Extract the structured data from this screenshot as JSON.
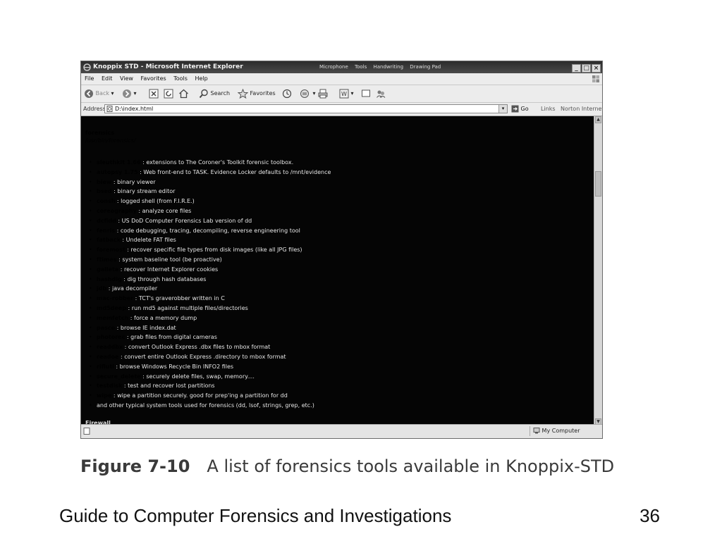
{
  "window": {
    "title": "Knoppix STD - Microsoft Internet Explorer",
    "quick_launch": [
      "Microphone",
      "Tools",
      "Handwriting",
      "Drawing Pad"
    ]
  },
  "menu": [
    "File",
    "Edit",
    "View",
    "Favorites",
    "Tools",
    "Help"
  ],
  "toolbar": {
    "back_label": "Back",
    "search_label": "Search",
    "favorites_label": "Favorites"
  },
  "address": {
    "label": "Address",
    "value": "D:\\index.html",
    "go_label": "Go",
    "links_label": "Links",
    "norton_label": "Norton Internet Security"
  },
  "page": {
    "heading": "forensics",
    "path": "/usr/bin/forensics/",
    "tools": [
      {
        "name": "sleuthkit 1.66",
        "desc": " : extensions to The Coroner's Toolkit forensic toolbox."
      },
      {
        "name": "autopsy 1.75",
        "desc": " : Web front-end to TASK. Evidence Locker defaults to /mnt/evidence"
      },
      {
        "name": "biew",
        "desc": " : binary viewer"
      },
      {
        "name": "bsed",
        "desc": " : binary stream editor"
      },
      {
        "name": "consh",
        "desc": " : logged shell (from F.I.R.E.)"
      },
      {
        "name": "coreography",
        "desc": " : analyze core files"
      },
      {
        "name": "dcfldd",
        "desc": " : US DoD Computer Forensics Lab version of dd"
      },
      {
        "name": "fenris",
        "desc": " : code debugging, tracing, decompiling, reverse engineering tool"
      },
      {
        "name": "fatback",
        "desc": " : Undelete FAT files"
      },
      {
        "name": "foremost",
        "desc": " : recover specific file types from disk images (like all JPG files)"
      },
      {
        "name": "ftimes",
        "desc": " : system baseline tool (be proactive)"
      },
      {
        "name": "galleta",
        "desc": " : recover Internet Explorer cookies"
      },
      {
        "name": "hashdig",
        "desc": " : dig through hash databases"
      },
      {
        "name": "jdb",
        "desc": " : java decompiler"
      },
      {
        "name": "mac-robber",
        "desc": " : TCT's graverobber written in C"
      },
      {
        "name": "md5deep",
        "desc": " : run md5 against multiple files/directories"
      },
      {
        "name": "memfetch",
        "desc": " : force a memory dump"
      },
      {
        "name": "pasco",
        "desc": " : browse IE index.dat"
      },
      {
        "name": "photorec",
        "desc": " : grab files from digital cameras"
      },
      {
        "name": "readdbx",
        "desc": " : convert Outlook Express .dbx files to mbox format"
      },
      {
        "name": "readoe",
        "desc": " : convert entire Outlook Express .directory to mbox format"
      },
      {
        "name": "rifiuti",
        "desc": " : browse Windows Recycle Bin INFO2 files"
      },
      {
        "name": "secure_delete",
        "desc": " : securely delete files, swap, memory...."
      },
      {
        "name": "testdisk",
        "desc": " : test and recover lost partitions"
      },
      {
        "name": "wipe",
        "desc": " : wipe a partition securely. good for prep'ing a partition for dd"
      },
      {
        "name": "",
        "desc": "and other typical system tools used for forensics (dd, lsof, strings, grep, etc.)"
      }
    ],
    "cutoff": "Firewall"
  },
  "status": {
    "zone": "My Computer"
  },
  "caption": {
    "figure": "Figure 7-10",
    "text": "A list of forensics tools available in Knoppix-STD"
  },
  "footer": {
    "title": "Guide to Computer Forensics and Investigations",
    "page_number": "36"
  }
}
